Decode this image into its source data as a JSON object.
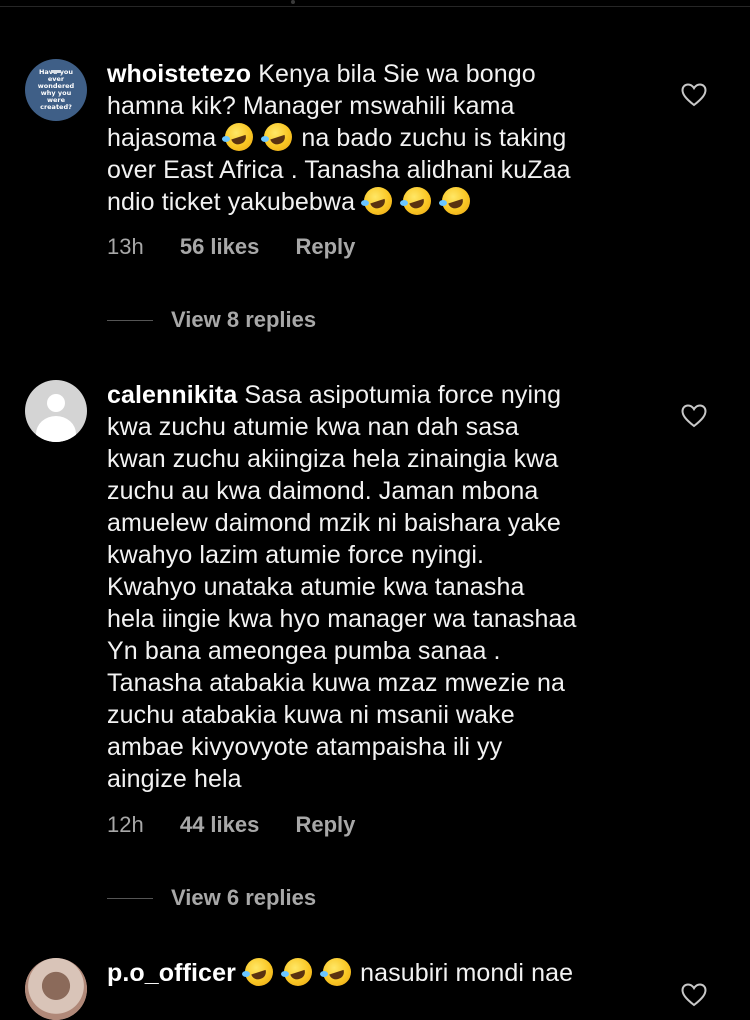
{
  "comments": [
    {
      "username": "whoistetezo",
      "avatar": {
        "type": "text-badge",
        "text": "Have you ever wondered why you were created?",
        "color": "#3f5f87"
      },
      "lines": [
        "Kenya bila Sie wa bongo",
        "hamna kik? Manager mswahili kama",
        [
          "hajasoma ",
          "emoji",
          " ",
          "emoji",
          "  na bado zuchu is taking"
        ],
        "over East Africa . Tanasha alidhani kuZaa",
        [
          "ndio ticket yakubebwa ",
          "emoji",
          " ",
          "emoji",
          " ",
          "emoji"
        ]
      ],
      "time": "13h",
      "likes": "56 likes",
      "reply": "Reply",
      "view_replies": "View 8 replies"
    },
    {
      "username": "calennikita",
      "avatar": {
        "type": "default"
      },
      "lines": [
        "Sasa asipotumia force nying",
        "kwa zuchu atumie kwa nan dah sasa",
        "kwan zuchu akiingiza hela zinaingia kwa",
        "zuchu au kwa daimond. Jaman mbona",
        "amuelew daimond mzik ni baishara yake",
        "kwahyo lazim atumie force nyingi.",
        "Kwahyo unataka atumie kwa tanasha",
        "hela iingie kwa hyo manager wa tanashaa",
        "Yn bana ameongea pumba sanaa .",
        "Tanasha atabakia kuwa mzaz mwezie na",
        "zuchu atabakia kuwa ni msanii wake",
        "ambae kivyovyote atampaisha ili yy",
        "aingize hela"
      ],
      "time": "12h",
      "likes": "44 likes",
      "reply": "Reply",
      "view_replies": "View 6 replies"
    },
    {
      "username": "p.o_officer",
      "avatar": {
        "type": "photo"
      },
      "first_line_emoji_count": 3,
      "first_line_text": " nasubiri mondi nae"
    }
  ],
  "icons": {
    "like": "heart-outline-icon",
    "emoji": "rolling-on-floor-laughing-emoji"
  },
  "colors": {
    "background": "#000000",
    "text": "#f2f2f2",
    "secondary": "#a8a8a8"
  }
}
